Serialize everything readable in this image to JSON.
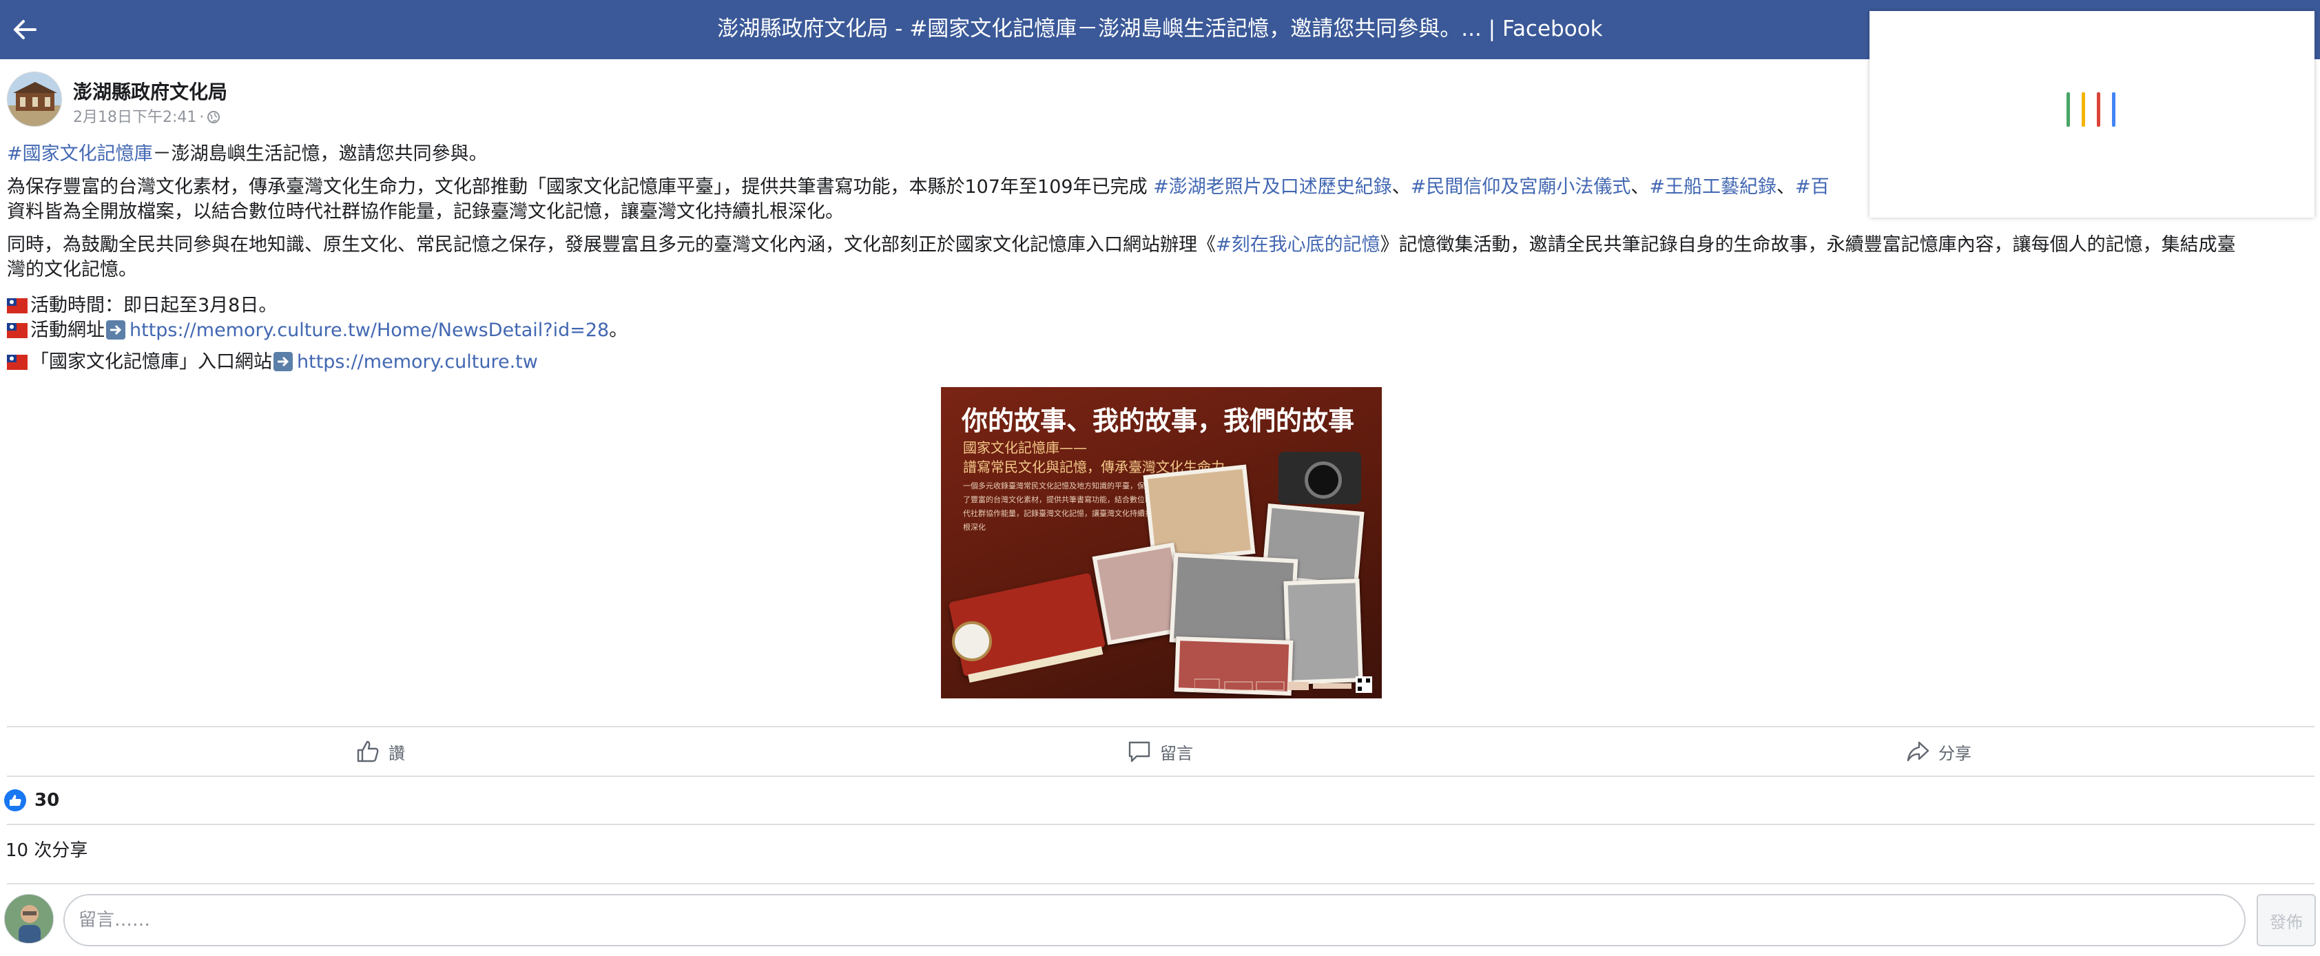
{
  "topbar": {
    "title": "澎湖縣政府文化局 - #國家文化記憶庫－澎湖島嶼生活記憶，邀請您共同參與。... | Facebook",
    "back_icon": "arrow-left-icon",
    "color": "#3b5998"
  },
  "loader": {
    "colors": [
      "#4aa564",
      "#f4b400",
      "#db4437",
      "#4285f4"
    ]
  },
  "post": {
    "author": "澎湖縣政府文化局",
    "timestamp": "2月18日下午2:41",
    "separator": "·",
    "privacy_icon": "globe-icon",
    "p1": {
      "tag": "#國家文化記憶庫",
      "text": "－澎湖島嶼生活記憶，邀請您共同參與。"
    },
    "p2": {
      "text1": "為保存豐富的台灣文化素材，傳承臺灣文化生命力，文化部推動「國家文化記憶庫平臺」，提供共筆書寫功能，本縣於107年至109年已完成 ",
      "tag1": "#澎湖老照片及口述歷史紀錄",
      "sep1": "、",
      "tag2": "#民間信仰及宮廟小法儀式",
      "sep2": "、",
      "tag3": "#王船工藝紀錄",
      "sep3": "、",
      "tag4": "#百",
      "line2": "資料皆為全開放檔案，以結合數位時代社群協作能量，記錄臺灣文化記憶，讓臺灣文化持續扎根深化。"
    },
    "p3": {
      "text1": "同時，為鼓勵全民共同參與在地知識、原生文化、常民記憶之保存，發展豐富且多元的臺灣文化內涵，文化部刻正於國家文化記憶庫入口網站辦理《",
      "tag": "#刻在我心底的記憶",
      "text2": "》記憶徵集活動，邀請全民共筆記錄自身的生命故事，永續豐富記憶庫內容，讓每個人的記憶，集結成臺",
      "line2": "灣的文化記憶。"
    },
    "info": {
      "time_label": "活動時間：即日起至3月8日。",
      "url_label": "活動網址",
      "url": "https://memory.culture.tw/Home/NewsDetail?id=28",
      "url_end": "。",
      "portal_label": "「國家文化記憶庫」入口網站",
      "portal_url": "https://memory.culture.tw"
    },
    "image": {
      "title": "你的故事、我的故事，我們的故事",
      "sub1": "國家文化記憶庫——",
      "sub2": "譜寫常民文化與記憶，傳承臺灣文化生命力",
      "small_text": "一個多元收錄臺灣常民文化記憶及地方知識的平臺，保存了豐富的台灣文化素材，提供共筆書寫功能，結合數位時代社群協作能量，記錄臺灣文化記憶，讓臺灣文化持續扎根深化"
    }
  },
  "actions": {
    "like_label": "讚",
    "comment_label": "留言",
    "share_label": "分享"
  },
  "stats": {
    "likes": "30",
    "shares": "10 次分享"
  },
  "composer": {
    "placeholder": "留言……",
    "post_label": "發佈"
  }
}
